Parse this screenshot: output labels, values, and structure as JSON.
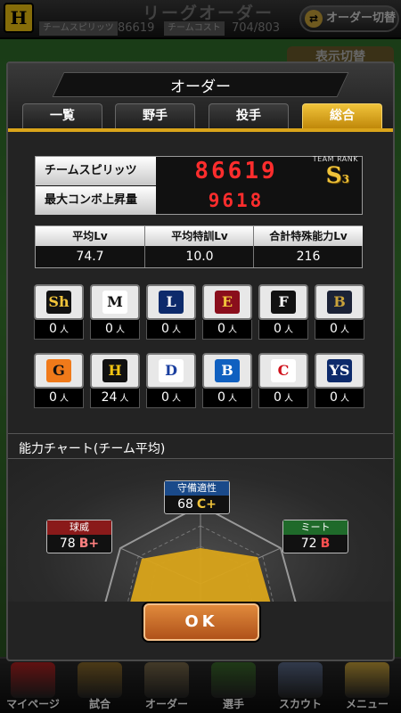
{
  "header": {
    "title": "リーグオーダー",
    "team_spirit_label": "チームスピリッツ",
    "team_spirit_value": "86619",
    "team_cost_label": "チームコスト",
    "team_cost_value": "704/803",
    "order_switch_label": "オーダー切替",
    "display_switch_label": "表示切替"
  },
  "modal": {
    "title": "オーダー",
    "tabs": [
      {
        "label": "一覧",
        "active": false
      },
      {
        "label": "野手",
        "active": false
      },
      {
        "label": "投手",
        "active": false
      },
      {
        "label": "総合",
        "active": true
      }
    ],
    "spirits": {
      "label": "チームスピリッツ",
      "value": "86619",
      "team_rank_label": "TEAM RANK",
      "rank": "S",
      "rank_sub": "3",
      "combo_label": "最大コンボ上昇量",
      "combo_value": "9618"
    },
    "averages": [
      {
        "label": "平均Lv",
        "value": "74.7"
      },
      {
        "label": "平均特訓Lv",
        "value": "10.0"
      },
      {
        "label": "合計特殊能力Lv",
        "value": "216"
      }
    ],
    "unit": "人",
    "teams": [
      {
        "name": "softbank",
        "mark": "Sh",
        "count": "0",
        "bg": "#111111",
        "fg": "#f0c33a"
      },
      {
        "name": "marines",
        "mark": "M",
        "count": "0",
        "bg": "#ffffff",
        "fg": "#111111"
      },
      {
        "name": "lions",
        "mark": "L",
        "count": "0",
        "bg": "#0d2a6b",
        "fg": "#ffffff"
      },
      {
        "name": "eagles",
        "mark": "E",
        "count": "0",
        "bg": "#8a0e1c",
        "fg": "#f0c33a"
      },
      {
        "name": "fighters",
        "mark": "F",
        "count": "0",
        "bg": "#111111",
        "fg": "#ffffff"
      },
      {
        "name": "buffaloes",
        "mark": "B",
        "count": "0",
        "bg": "#1b2236",
        "fg": "#c9a23a"
      },
      {
        "name": "giants",
        "mark": "G",
        "count": "0",
        "bg": "#f07a1a",
        "fg": "#111111"
      },
      {
        "name": "tigers",
        "mark": "H",
        "count": "24",
        "bg": "#111111",
        "fg": "#f3c512"
      },
      {
        "name": "dragons",
        "mark": "D",
        "count": "0",
        "bg": "#ffffff",
        "fg": "#1a3fa0"
      },
      {
        "name": "baystars",
        "mark": "B",
        "count": "0",
        "bg": "#1060c0",
        "fg": "#ffffff"
      },
      {
        "name": "carp",
        "mark": "C",
        "count": "0",
        "bg": "#ffffff",
        "fg": "#d0101a"
      },
      {
        "name": "swallows",
        "mark": "YS",
        "count": "0",
        "bg": "#0d2a6b",
        "fg": "#ffffff"
      }
    ],
    "chart_title": "能力チャート(チーム平均)",
    "chart": {
      "defense": {
        "label": "守備適性",
        "value": "68",
        "grade": "C+",
        "color": "#f0c33a",
        "bg": "#1a4a8a"
      },
      "power": {
        "label": "球威",
        "value": "78",
        "grade": "B+",
        "color": "#ff8080",
        "bg": "#8a1a1a"
      },
      "meet": {
        "label": "ミート",
        "value": "72",
        "grade": "B",
        "color": "#ff5050",
        "bg": "#1f6a2a"
      },
      "fill_color": "#d9a41a"
    },
    "ok_label": "OK"
  },
  "bottom_nav": [
    {
      "label": "マイページ",
      "color": "#b02020"
    },
    {
      "label": "試合",
      "color": "#8a6a2a"
    },
    {
      "label": "オーダー",
      "color": "#7a6a4a"
    },
    {
      "label": "選手",
      "color": "#3a6a2a"
    },
    {
      "label": "スカウト",
      "color": "#5a6a8a"
    },
    {
      "label": "メニュー",
      "color": "#c9a23a"
    }
  ]
}
